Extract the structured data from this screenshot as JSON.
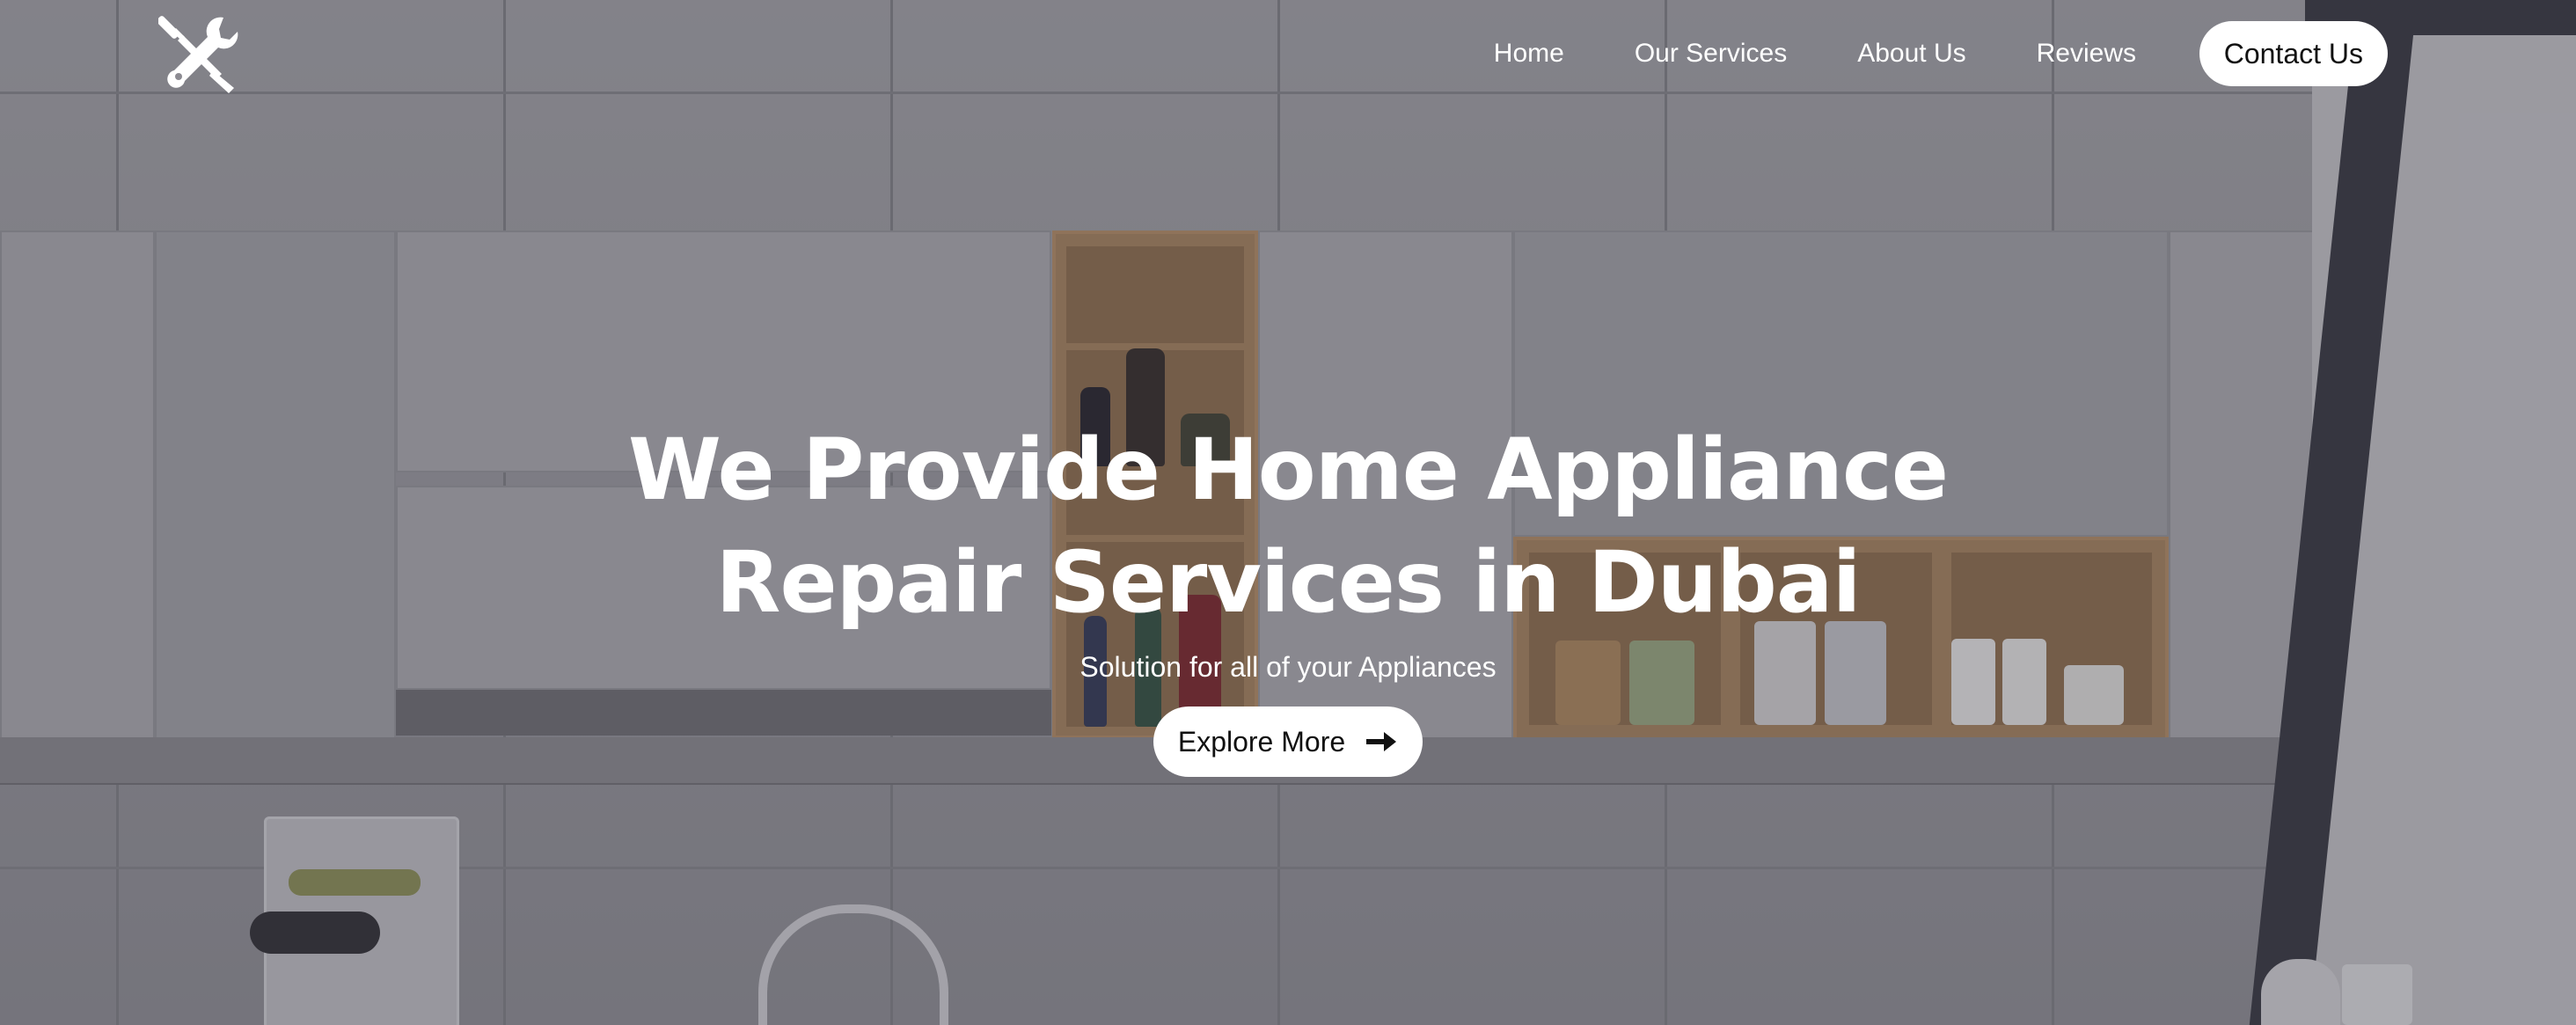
{
  "header": {
    "logo_icon": "wrench-screwdriver-icon",
    "nav": [
      {
        "label": "Home"
      },
      {
        "label": "Our Services"
      },
      {
        "label": "About Us"
      },
      {
        "label": "Reviews"
      }
    ],
    "contact_label": "Contact Us"
  },
  "hero": {
    "title": "We Provide Home Appliance Repair Services in Dubai",
    "subtitle": "Solution for all of your Appliances",
    "cta_label": "Explore More",
    "cta_icon": "arrow-right-icon"
  },
  "colors": {
    "text": "#ffffff",
    "button_bg": "#ffffff",
    "button_text": "#111111"
  }
}
